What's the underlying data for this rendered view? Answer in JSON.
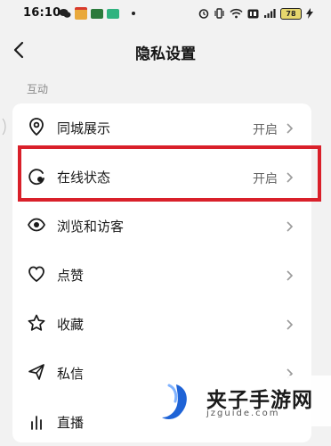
{
  "status_bar": {
    "time": "16:10",
    "battery": "78"
  },
  "header": {
    "title": "隐私设置"
  },
  "section": {
    "title": "互动"
  },
  "rows": [
    {
      "label": "同城展示",
      "value": "开启",
      "icon": "location-pin-icon"
    },
    {
      "label": "在线状态",
      "value": "开启",
      "icon": "online-status-icon"
    },
    {
      "label": "浏览和访客",
      "value": "",
      "icon": "eye-icon"
    },
    {
      "label": "点赞",
      "value": "",
      "icon": "heart-icon"
    },
    {
      "label": "收藏",
      "value": "",
      "icon": "star-icon"
    },
    {
      "label": "私信",
      "value": "",
      "icon": "send-icon"
    },
    {
      "label": "直播",
      "value": "",
      "icon": "live-chart-icon"
    }
  ],
  "watermark": {
    "cn": "夹子手游网",
    "en": "jzguide.com"
  },
  "colors": {
    "highlight": "#d9202a",
    "background": "#f2f2f2",
    "card": "#ffffff",
    "watermark_blue": "#1e63d6"
  }
}
